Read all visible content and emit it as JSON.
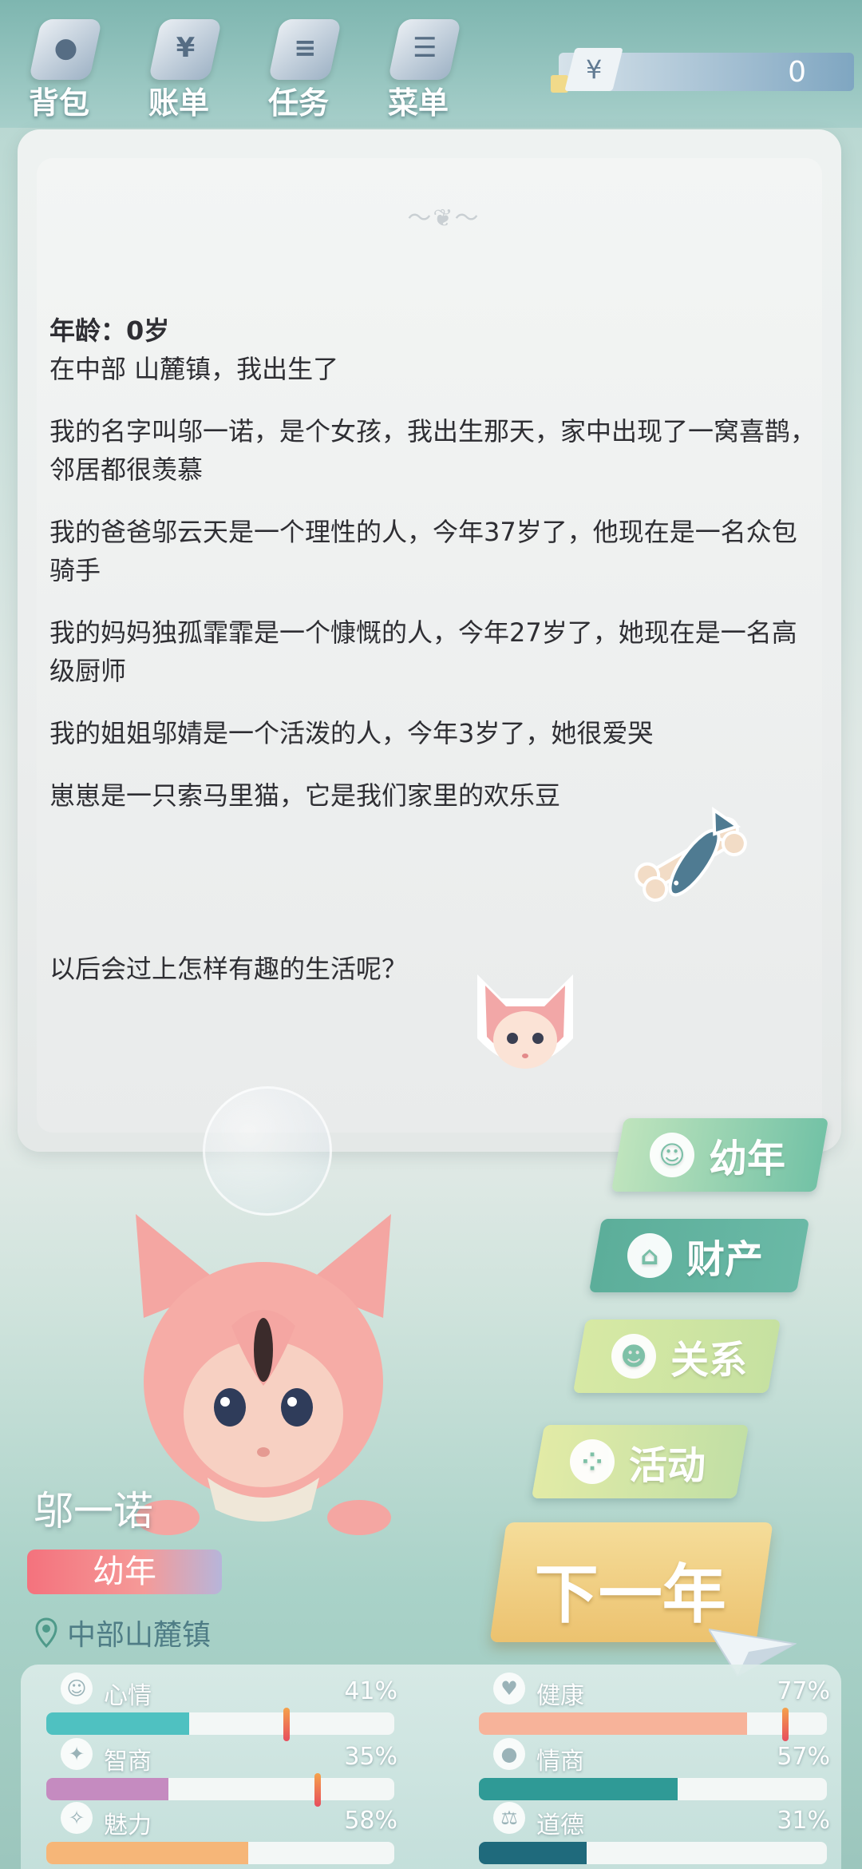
{
  "top_nav": {
    "items": [
      {
        "label": "背包",
        "icon": "backpack-icon",
        "glyph": "●"
      },
      {
        "label": "账单",
        "icon": "bill-icon",
        "glyph": "¥"
      },
      {
        "label": "任务",
        "icon": "task-icon",
        "glyph": "≡"
      },
      {
        "label": "菜单",
        "icon": "menu-icon",
        "glyph": "☰"
      }
    ],
    "money_symbol": "¥",
    "money_value": "0"
  },
  "story": {
    "age_line": "年龄：0岁",
    "paragraphs": [
      "在中部 山麓镇，我出生了",
      "我的名字叫邬一诺，是个女孩，我出生那天，家中出现了一窝喜鹊，邻居都很羡慕",
      "我的爸爸邬云天是一个理性的人，今年37岁了，他现在是一名众包骑手",
      "我的妈妈独孤霏霏是一个慷慨的人，今年27岁了，她现在是一名高级厨师",
      "我的姐姐邬婧是一个活泼的人，今年3岁了，她很爱哭",
      "崽崽是一只索马里猫，它是我们家里的欢乐豆"
    ],
    "question": "以后会过上怎样有趣的生活呢？"
  },
  "side_menu": {
    "stage_button": "幼年",
    "property_button": "财产",
    "relation_button": "关系",
    "activity_button": "活动",
    "next_year_button": "下一年"
  },
  "character": {
    "name": "邬一诺",
    "stage": "幼年",
    "location": "中部山麓镇"
  },
  "stats": [
    {
      "name": "心情",
      "percent": "41%",
      "value": 41,
      "color": "#4fc1c1",
      "icon": "mood-icon",
      "glyph": "☺",
      "marker": 69
    },
    {
      "name": "健康",
      "percent": "77%",
      "value": 77,
      "color": "#f7b39a",
      "icon": "health-icon",
      "glyph": "♥",
      "marker": 88
    },
    {
      "name": "智商",
      "percent": "35%",
      "value": 35,
      "color": "#c58bc0",
      "icon": "iq-icon",
      "glyph": "✦",
      "marker": 78
    },
    {
      "name": "情商",
      "percent": "57%",
      "value": 57,
      "color": "#2f9a96",
      "icon": "eq-icon",
      "glyph": "●",
      "marker": null
    },
    {
      "name": "魅力",
      "percent": "58%",
      "value": 58,
      "color": "#f6b678",
      "icon": "charm-icon",
      "glyph": "✧",
      "marker": null
    },
    {
      "name": "道德",
      "percent": "31%",
      "value": 31,
      "color": "#1f6a7c",
      "icon": "morality-icon",
      "glyph": "⚖",
      "marker": null
    }
  ]
}
